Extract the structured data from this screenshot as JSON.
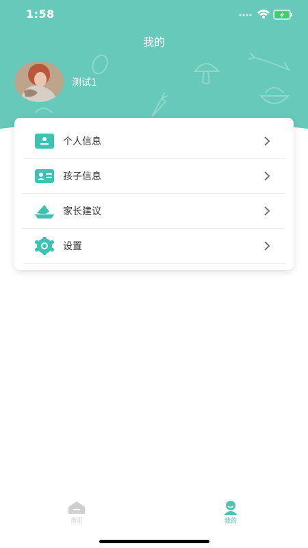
{
  "status_bar": {
    "time": "1:58"
  },
  "header": {
    "title": "我的",
    "background_color": "#66c9b9"
  },
  "profile": {
    "username": "测试1"
  },
  "menu": {
    "items": [
      {
        "label": "个人信息",
        "icon": "id-badge-icon"
      },
      {
        "label": "孩子信息",
        "icon": "id-card-icon"
      },
      {
        "label": "家长建议",
        "icon": "suggestion-tray-icon"
      },
      {
        "label": "设置",
        "icon": "gear-icon"
      }
    ]
  },
  "tabbar": {
    "tabs": [
      {
        "label": "首页",
        "icon": "home-icon",
        "active": false
      },
      {
        "label": "我的",
        "icon": "user-icon",
        "active": true
      }
    ],
    "active_color": "#4fc3b1",
    "inactive_color": "#d0d0d0"
  }
}
